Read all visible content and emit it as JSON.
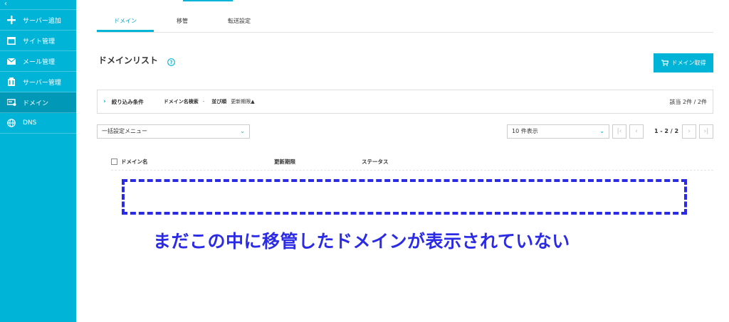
{
  "sidebar": {
    "collapse_label": "‹",
    "items": [
      {
        "label": "サーバー追加",
        "icon": "plus-icon"
      },
      {
        "label": "サイト管理",
        "icon": "window-icon"
      },
      {
        "label": "メール管理",
        "icon": "envelope-icon"
      },
      {
        "label": "サーバー管理",
        "icon": "server-icon"
      },
      {
        "label": "ドメイン",
        "icon": "domain-icon",
        "active": true
      },
      {
        "label": "DNS",
        "icon": "globe-icon"
      }
    ]
  },
  "tabs": [
    {
      "label": "ドメイン",
      "active": true
    },
    {
      "label": "移管"
    },
    {
      "label": "転送設定"
    }
  ],
  "page": {
    "title": "ドメインリスト",
    "help_icon": "question-circle-icon",
    "get_button_label": "ドメイン取得",
    "get_button_icon": "cart-icon"
  },
  "filter": {
    "chevron": "›",
    "label": "絞り込み条件",
    "search_key": "ドメイン名検索",
    "search_value": "-",
    "sort_key": "並び順",
    "sort_value": "更新期限▲",
    "count": "該当 2件 / 2件"
  },
  "toolbar": {
    "bulk_menu": "一括設定メニュー",
    "per_page": "10 件表示",
    "page_info": "1 - 2 / 2",
    "first_label": "|‹",
    "prev_label": "‹",
    "next_label": "›",
    "last_label": "›|",
    "select_arrow": "⌄"
  },
  "table": {
    "headers": [
      "ドメイン名",
      "更新期限",
      "ステータス"
    ]
  },
  "annotation": {
    "text": "まだこの中に移管したドメインが表示されていない"
  },
  "colors": {
    "accent": "#00b4d8",
    "sidebar_active": "#0098b7",
    "annotation": "#2b2be6"
  }
}
